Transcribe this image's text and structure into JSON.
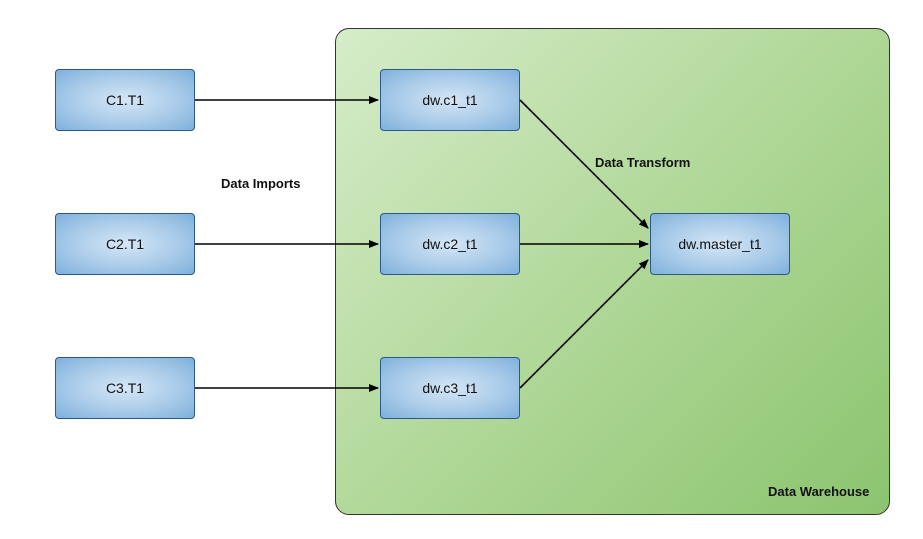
{
  "sources": [
    {
      "label": "C1.T1"
    },
    {
      "label": "C2.T1"
    },
    {
      "label": "C3.T1"
    }
  ],
  "dw_tables": [
    {
      "label": "dw.c1_t1"
    },
    {
      "label": "dw.c2_t1"
    },
    {
      "label": "dw.c3_t1"
    }
  ],
  "master": {
    "label": "dw.master_t1"
  },
  "labels": {
    "imports": "Data Imports",
    "transform": "Data Transform",
    "warehouse": "Data Warehouse"
  }
}
